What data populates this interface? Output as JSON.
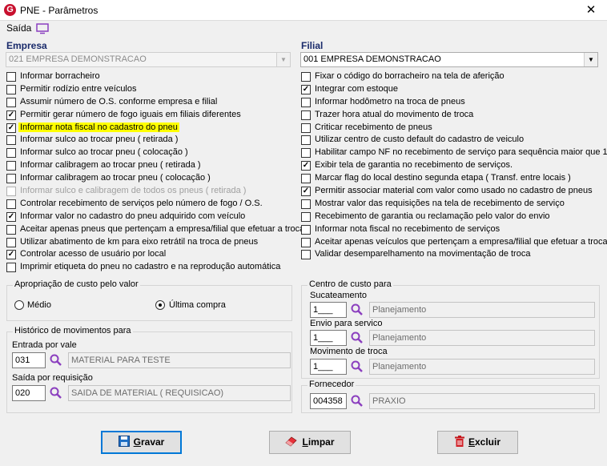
{
  "window": {
    "title": "PNE - Parâmetros",
    "logo_letter": "G",
    "close_glyph": "✕"
  },
  "menu": {
    "exit_label": "Saída"
  },
  "empresa": {
    "label": "Empresa",
    "value": "021 EMPRESA DEMONSTRACAO"
  },
  "filial": {
    "label": "Filial",
    "value": "001 EMPRESA DEMONSTRACAO"
  },
  "left_checks": [
    {
      "label": "Informar borracheiro",
      "checked": false
    },
    {
      "label": "Permitir rodízio entre veículos",
      "checked": false
    },
    {
      "label": "Assumir número de O.S. conforme empresa e filial",
      "checked": false
    },
    {
      "label": "Permitir gerar número de fogo iguais em filiais diferentes",
      "checked": true
    },
    {
      "label": "Informar nota fiscal no cadastro do pneu",
      "checked": true,
      "highlight": true
    },
    {
      "label": "Informar sulco ao trocar pneu ( retirada )",
      "checked": false
    },
    {
      "label": "Informar sulco ao trocar pneu ( colocação )",
      "checked": false
    },
    {
      "label": "Informar calibragem ao trocar pneu ( retirada )",
      "checked": false
    },
    {
      "label": "Informar calibragem ao trocar pneu ( colocação )",
      "checked": false
    },
    {
      "label": "Informar sulco e calibragem de todos os pneus ( retirada )",
      "checked": false,
      "disabled": true
    },
    {
      "label": "Controlar recebimento de serviços pelo número de fogo / O.S.",
      "checked": false
    },
    {
      "label": "Informar valor no cadastro do pneu adquirido com veículo",
      "checked": true
    },
    {
      "label": "Aceitar apenas pneus que pertençam a empresa/filial que efetuar a troca",
      "checked": false
    },
    {
      "label": "Utilizar abatimento de km para eixo retrátil na troca de pneus",
      "checked": false
    },
    {
      "label": "Controlar acesso de usuário por local",
      "checked": true
    },
    {
      "label": "Imprimir etiqueta do pneu no cadastro e na reprodução automática",
      "checked": false
    }
  ],
  "right_checks": [
    {
      "label": "Fixar o código do borracheiro na tela de aferição",
      "checked": false
    },
    {
      "label": "Integrar com estoque",
      "checked": true
    },
    {
      "label": "Informar hodômetro na troca de pneus",
      "checked": false
    },
    {
      "label": "Trazer hora atual do movimento de troca",
      "checked": false
    },
    {
      "label": "Criticar recebimento de pneus",
      "checked": false
    },
    {
      "label": "Utilizar centro de custo default do cadastro de veiculo",
      "checked": false
    },
    {
      "label": "Habilitar campo NF no recebimento de serviço para sequência maior que 1",
      "checked": false
    },
    {
      "label": "Exibir tela de garantia no recebimento de serviços.",
      "checked": true
    },
    {
      "label": "Marcar flag do local destino segunda etapa ( Transf. entre locais )",
      "checked": false
    },
    {
      "label": "Permitir associar material com valor como usado no cadastro de pneus",
      "checked": true
    },
    {
      "label": "Mostrar valor das requisições na tela de recebimento de serviço",
      "checked": false
    },
    {
      "label": "Recebimento de garantia ou reclamação pelo valor do envio",
      "checked": false
    },
    {
      "label": "Informar nota fiscal no recebimento de serviços",
      "checked": false
    },
    {
      "label": "Aceitar apenas veículos que pertençam a empresa/filial que efetuar a troca",
      "checked": false
    },
    {
      "label": "Validar desemparelhamento na movimentação de troca",
      "checked": false
    }
  ],
  "apropriacao": {
    "title": "Apropriação de custo pelo valor",
    "opt_medio": "Médio",
    "opt_ultima": "Última compra",
    "selected": "ultima"
  },
  "historico": {
    "title": "Histórico de movimentos para",
    "entrada_label": "Entrada por vale",
    "entrada_code": "031",
    "entrada_desc": "MATERIAL PARA TESTE",
    "saida_label": "Saída por requisição",
    "saida_code": "020",
    "saida_desc": "SAIDA DE MATERIAL ( REQUISICAO)"
  },
  "centro_custo": {
    "title": "Centro de custo para",
    "sucateamento_label": "Sucateamento",
    "sucateamento_code": "1___",
    "sucateamento_desc": "Planejamento",
    "envio_label": "Envio para servico",
    "envio_code": "1___",
    "envio_desc": "Planejamento",
    "movimento_label": "Movimento de troca",
    "movimento_code": "1___",
    "movimento_desc": "Planejamento"
  },
  "fornecedor": {
    "title": "Fornecedor",
    "code": "004358",
    "desc": "PRAXIO"
  },
  "buttons": {
    "gravar_first": "G",
    "gravar_rest": "ravar",
    "limpar_first": "L",
    "limpar_rest": "impar",
    "excluir_first": "E",
    "excluir_rest": "xcluir"
  },
  "colors": {
    "accent": "#0078d7",
    "label_blue": "#1a2b6b",
    "highlight": "#ffff00",
    "search_icon": "#8b3fbf"
  }
}
